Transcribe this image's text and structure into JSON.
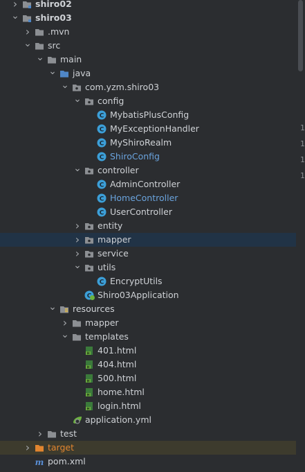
{
  "tree": [
    {
      "label": "shiro02",
      "depth": 0,
      "arrow": "right",
      "icon": "folder-module-icon",
      "style": "bold"
    },
    {
      "label": "shiro03",
      "depth": 0,
      "arrow": "down",
      "icon": "folder-module-icon",
      "style": "bold"
    },
    {
      "label": ".mvn",
      "depth": 1,
      "arrow": "right",
      "icon": "folder-icon"
    },
    {
      "label": "src",
      "depth": 1,
      "arrow": "down",
      "icon": "folder-icon"
    },
    {
      "label": "main",
      "depth": 2,
      "arrow": "down",
      "icon": "folder-icon"
    },
    {
      "label": "java",
      "depth": 3,
      "arrow": "down",
      "icon": "folder-source-icon"
    },
    {
      "label": "com.yzm.shiro03",
      "depth": 4,
      "arrow": "down",
      "icon": "package-icon"
    },
    {
      "label": "config",
      "depth": 5,
      "arrow": "down",
      "icon": "package-icon"
    },
    {
      "label": "MybatisPlusConfig",
      "depth": 6,
      "icon": "class-icon"
    },
    {
      "label": "MyExceptionHandler",
      "depth": 6,
      "icon": "class-icon"
    },
    {
      "label": "MyShiroRealm",
      "depth": 6,
      "icon": "class-icon"
    },
    {
      "label": "ShiroConfig",
      "depth": 6,
      "icon": "class-icon",
      "style": "blue"
    },
    {
      "label": "controller",
      "depth": 5,
      "arrow": "down",
      "icon": "package-icon"
    },
    {
      "label": "AdminController",
      "depth": 6,
      "icon": "class-icon"
    },
    {
      "label": "HomeController",
      "depth": 6,
      "icon": "class-icon",
      "style": "blue"
    },
    {
      "label": "UserController",
      "depth": 6,
      "icon": "class-icon"
    },
    {
      "label": "entity",
      "depth": 5,
      "arrow": "right",
      "icon": "package-icon"
    },
    {
      "label": "mapper",
      "depth": 5,
      "arrow": "right",
      "icon": "package-icon",
      "selected": true
    },
    {
      "label": "service",
      "depth": 5,
      "arrow": "right",
      "icon": "package-icon"
    },
    {
      "label": "utils",
      "depth": 5,
      "arrow": "down",
      "icon": "package-icon"
    },
    {
      "label": "EncryptUtils",
      "depth": 6,
      "icon": "class-icon"
    },
    {
      "label": "Shiro03Application",
      "depth": 5,
      "icon": "spring-class-icon"
    },
    {
      "label": "resources",
      "depth": 3,
      "arrow": "down",
      "icon": "folder-resources-icon"
    },
    {
      "label": "mapper",
      "depth": 4,
      "arrow": "right",
      "icon": "folder-icon"
    },
    {
      "label": "templates",
      "depth": 4,
      "arrow": "down",
      "icon": "folder-icon"
    },
    {
      "label": "401.html",
      "depth": 5,
      "icon": "html-file-icon"
    },
    {
      "label": "404.html",
      "depth": 5,
      "icon": "html-file-icon"
    },
    {
      "label": "500.html",
      "depth": 5,
      "icon": "html-file-icon"
    },
    {
      "label": "home.html",
      "depth": 5,
      "icon": "html-file-icon"
    },
    {
      "label": "login.html",
      "depth": 5,
      "icon": "html-file-icon"
    },
    {
      "label": "application.yml",
      "depth": 4,
      "icon": "yaml-file-icon"
    },
    {
      "label": "test",
      "depth": 2,
      "arrow": "right",
      "icon": "folder-icon"
    },
    {
      "label": "target",
      "depth": 1,
      "arrow": "right",
      "icon": "folder-excluded-icon",
      "style": "orange",
      "target": true
    },
    {
      "label": "pom.xml",
      "depth": 1,
      "icon": "maven-file-icon"
    }
  ],
  "gutter": [
    "1",
    "1",
    "1",
    "1"
  ],
  "colors": {
    "background": "#2b2d30",
    "selection": "#213346",
    "excluded_row": "#3d3b2d",
    "blue_text": "#6aa3dd",
    "orange_text": "#e1852f",
    "class_icon": "#3c9fd8",
    "folder": "#8c8f93"
  }
}
